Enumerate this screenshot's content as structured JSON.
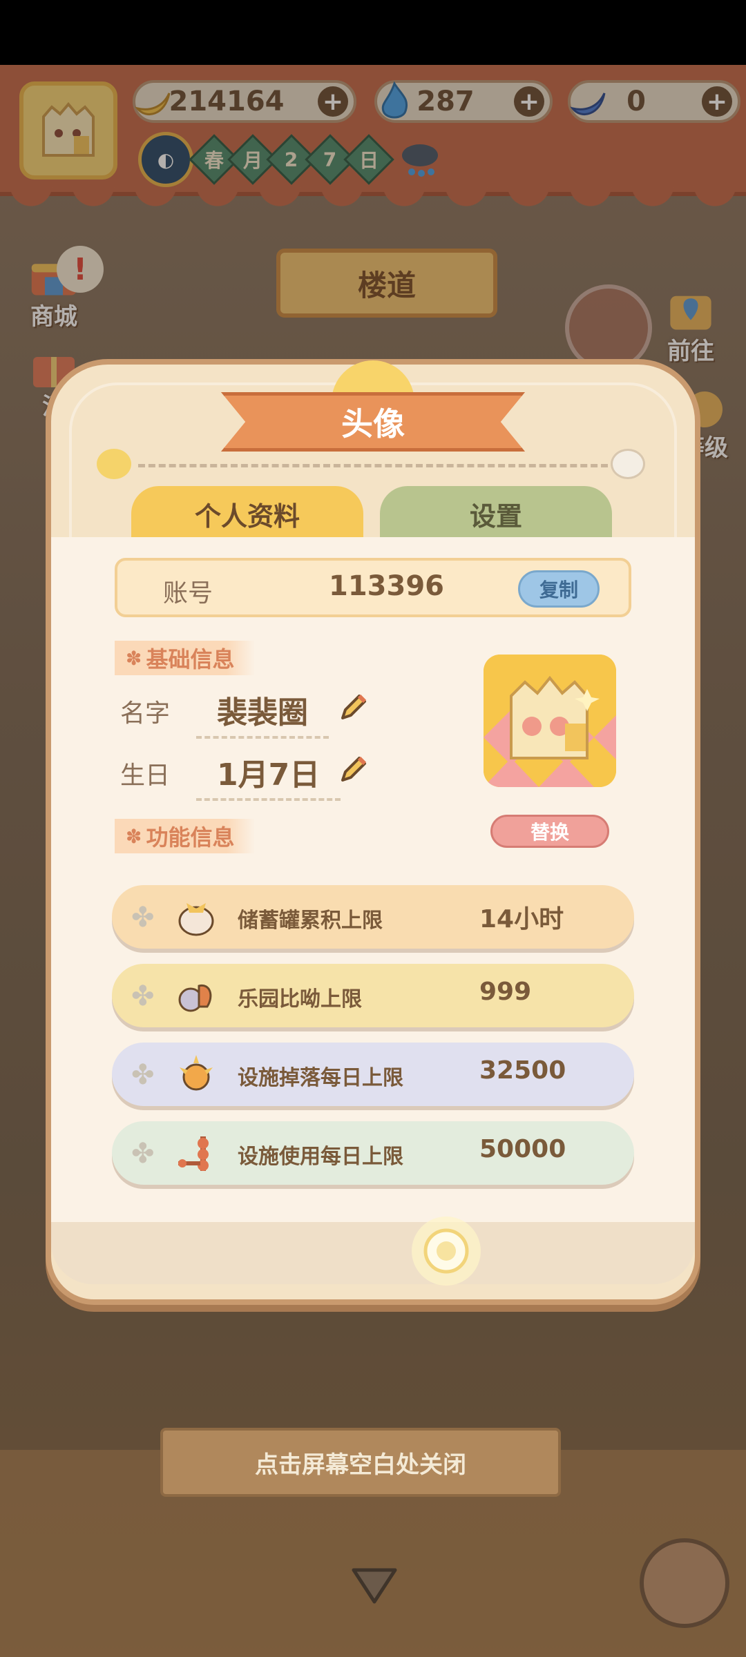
{
  "hud": {
    "banana": "214164",
    "flame": "287",
    "blue_banana": "0",
    "date_season": "春",
    "date_month": "月",
    "date_d1": "2",
    "date_d2": "7",
    "date_day": "日"
  },
  "side": {
    "shop": "商城",
    "activity": "活",
    "go": "前往",
    "level": "等级",
    "sign": "楼道"
  },
  "modal": {
    "title": "头像",
    "tab_profile": "个人资料",
    "tab_settings": "设置",
    "account_label": "账号",
    "account_value": "113396",
    "copy_label": "复制",
    "basic_section": "基础信息",
    "name_label": "名字",
    "name_value": "裴裴圈",
    "birthday_label": "生日",
    "birthday_value": "1月7日",
    "swap_label": "替换",
    "func_section": "功能信息",
    "stats": [
      {
        "name": "储蓄罐累积上限",
        "value": "14小时",
        "color": "#f9dcb0"
      },
      {
        "name": "乐园比呦上限",
        "value": "999",
        "color": "#f6e3a9"
      },
      {
        "name": "设施掉落每日上限",
        "value": "32500",
        "color": "#e0e0ef"
      },
      {
        "name": "设施使用每日上限",
        "value": "50000",
        "color": "#e3ecdd"
      }
    ]
  },
  "close_hint": "点击屏幕空白处关闭"
}
